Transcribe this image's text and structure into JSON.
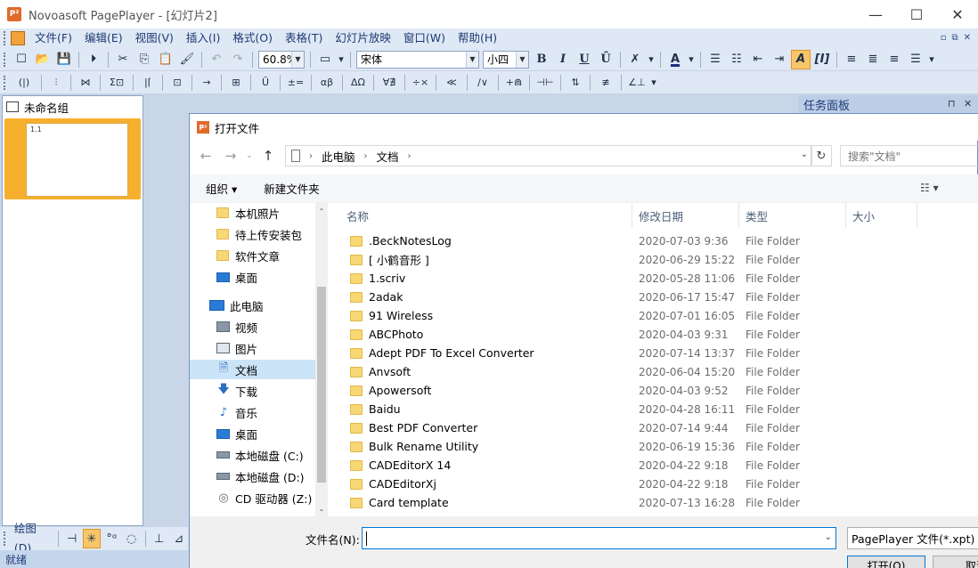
{
  "window": {
    "title": "Novoasoft PagePlayer - [幻灯片2]",
    "app_icon_text": "P²",
    "minimize": "—",
    "maximize": "☐",
    "close": "✕"
  },
  "menubar": {
    "items": [
      "文件(F)",
      "编辑(E)",
      "视图(V)",
      "插入(I)",
      "格式(O)",
      "表格(T)",
      "幻灯片放映",
      "窗口(W)",
      "帮助(H)"
    ],
    "right_controls": [
      "▫",
      "⧉",
      "✕"
    ]
  },
  "toolbar1": {
    "zoom": "60.8%",
    "font": "宋体",
    "font_size": "小四",
    "bold": "B",
    "italic": "I",
    "underline": "U",
    "strike": "Ū",
    "color_a": "A"
  },
  "toolbar2": {
    "items": [
      "(|)",
      "⫶",
      "⋈",
      "Σ⊡",
      "|⌈",
      "⊡",
      "→",
      "⊞",
      "Ŭ",
      "±=",
      "αβ",
      "ΔΩ",
      "∀∄",
      "÷×",
      "≪",
      "∕∨",
      "+⋒",
      "⊣⊢",
      "⇅",
      "≢",
      "∠⊥"
    ]
  },
  "left_panel": {
    "group_name": "未命名组",
    "slide_label": "1.1"
  },
  "drawbar": {
    "label": "绘图(D)"
  },
  "status": {
    "text": "就绪"
  },
  "task_panel": {
    "title": "任务面板",
    "pin": "⊓",
    "close": "✕"
  },
  "dialog": {
    "title": "打开文件",
    "title_icon_text": "P²",
    "breadcrumb": [
      "此电脑",
      "文档"
    ],
    "search_placeholder": "搜索\"文档\"",
    "organize": "组织 ▾",
    "new_folder": "新建文件夹",
    "nav_tree": [
      {
        "label": "本机照片",
        "icon": "folder-icon",
        "selected": false
      },
      {
        "label": "待上传安装包",
        "icon": "folder-icon",
        "selected": false
      },
      {
        "label": "软件文章",
        "icon": "folder-icon",
        "selected": false
      },
      {
        "label": "桌面",
        "icon": "desktop-icon",
        "selected": false
      },
      {
        "label": "此电脑",
        "icon": "computer-icon",
        "selected": false
      },
      {
        "label": "视频",
        "icon": "video-icon",
        "selected": false
      },
      {
        "label": "图片",
        "icon": "picture-icon",
        "selected": false
      },
      {
        "label": "文档",
        "icon": "document-icon",
        "selected": true
      },
      {
        "label": "下载",
        "icon": "download-icon",
        "selected": false
      },
      {
        "label": "音乐",
        "icon": "music-icon",
        "selected": false
      },
      {
        "label": "桌面",
        "icon": "desktop-icon",
        "selected": false
      },
      {
        "label": "本地磁盘 (C:)",
        "icon": "drive-icon",
        "selected": false
      },
      {
        "label": "本地磁盘 (D:)",
        "icon": "drive-icon",
        "selected": false
      },
      {
        "label": "CD 驱动器 (Z:)",
        "icon": "cd-drive-icon",
        "selected": false
      }
    ],
    "columns": [
      "名称",
      "修改日期",
      "类型",
      "大小"
    ],
    "files": [
      {
        "name": ".BeckNotesLog",
        "date": "2020-07-03 9:36",
        "type": "File Folder"
      },
      {
        "name": "[ 小鹤音形 ]",
        "date": "2020-06-29 15:22",
        "type": "File Folder"
      },
      {
        "name": "1.scriv",
        "date": "2020-05-28 11:06",
        "type": "File Folder"
      },
      {
        "name": "2adak",
        "date": "2020-06-17 15:47",
        "type": "File Folder"
      },
      {
        "name": "91 Wireless",
        "date": "2020-07-01 16:05",
        "type": "File Folder"
      },
      {
        "name": "ABCPhoto",
        "date": "2020-04-03 9:31",
        "type": "File Folder"
      },
      {
        "name": "Adept PDF To Excel Converter",
        "date": "2020-07-14 13:37",
        "type": "File Folder"
      },
      {
        "name": "Anvsoft",
        "date": "2020-06-04 15:20",
        "type": "File Folder"
      },
      {
        "name": "Apowersoft",
        "date": "2020-04-03 9:52",
        "type": "File Folder"
      },
      {
        "name": "Baidu",
        "date": "2020-04-28 16:11",
        "type": "File Folder"
      },
      {
        "name": "Best PDF Converter",
        "date": "2020-07-14 9:44",
        "type": "File Folder"
      },
      {
        "name": "Bulk Rename Utility",
        "date": "2020-06-19 15:36",
        "type": "File Folder"
      },
      {
        "name": "CADEditorX 14",
        "date": "2020-04-22 9:18",
        "type": "File Folder"
      },
      {
        "name": "CADEditorXj",
        "date": "2020-04-22 9:18",
        "type": "File Folder"
      },
      {
        "name": "Card template",
        "date": "2020-07-13 16:28",
        "type": "File Folder"
      }
    ],
    "filename_label": "文件名(N):",
    "filename_value": "",
    "filter": "PagePlayer 文件(*.xpt)",
    "open_button": "打开(O)",
    "cancel_button": "取消"
  },
  "colors": {
    "accent": "#0078d7",
    "chrome": "#dfe8f5",
    "slide_highlight": "#f7b02d",
    "folder": "#f8d775"
  }
}
